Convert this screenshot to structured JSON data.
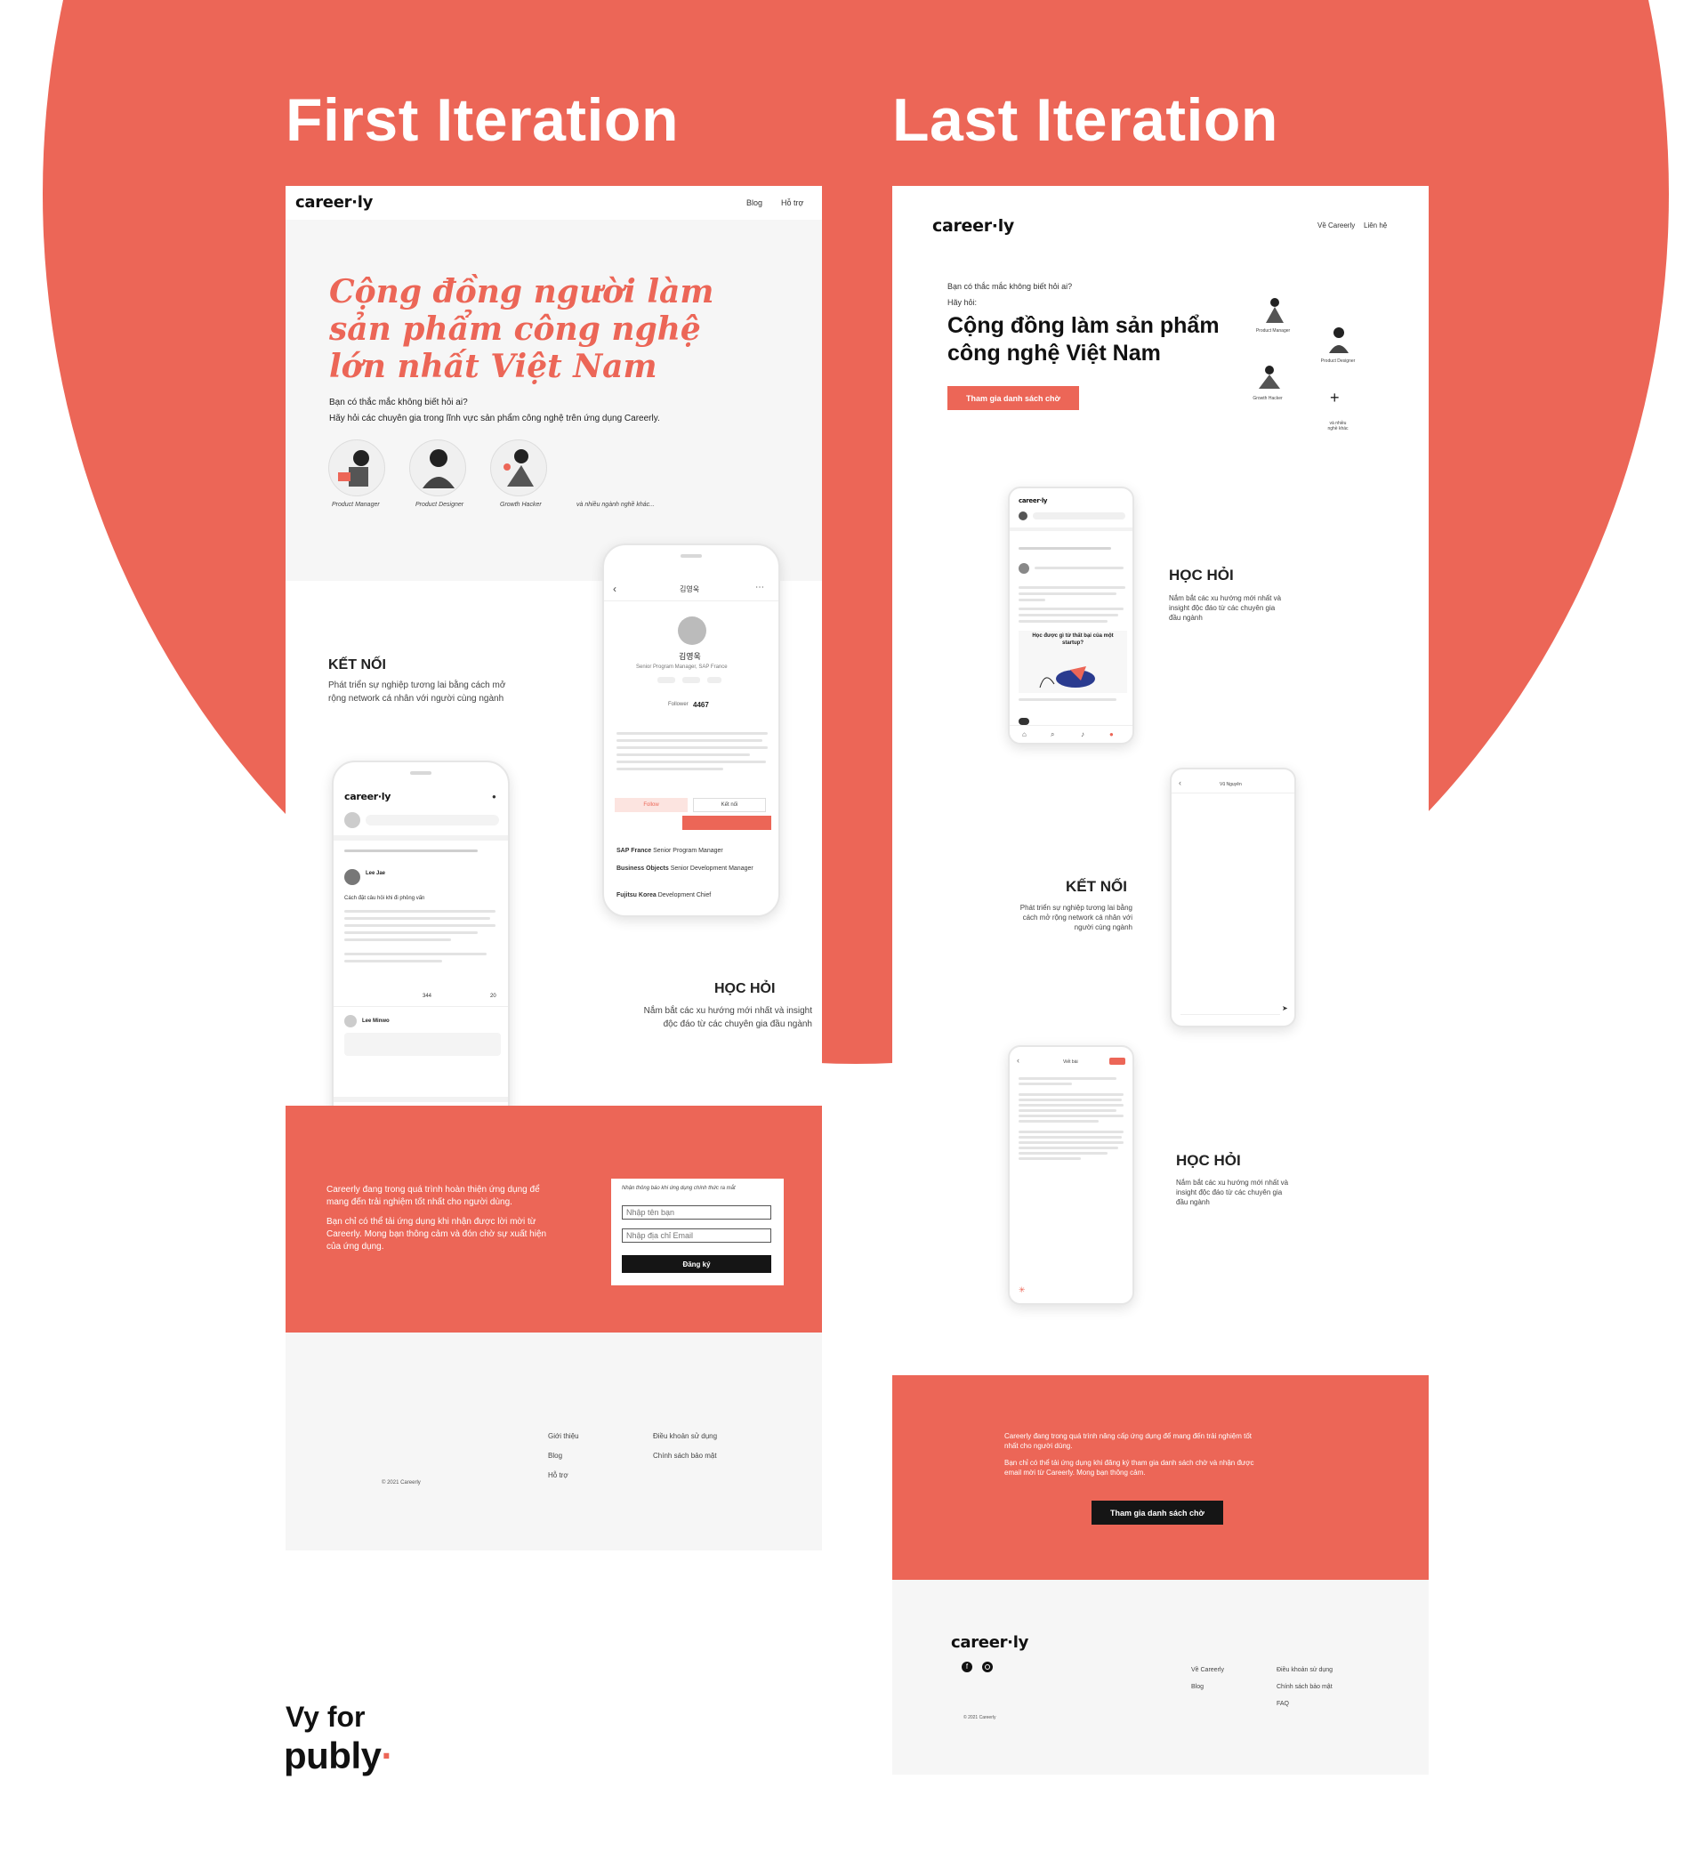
{
  "headings": {
    "first": "First Iteration",
    "last": "Last Iteration"
  },
  "brand": {
    "logo": "career·ly",
    "coral": "#ec6657",
    "dark": "#151515"
  },
  "credit": {
    "line1": "Vy for",
    "line2": "publy"
  },
  "first": {
    "nav": [
      "Blog",
      "Hỗ trợ"
    ],
    "hero_title": [
      "Cộng đồng người làm",
      "sản phẩm công nghệ",
      "lớn nhất Việt Nam"
    ],
    "hero_sub1": "Bạn có thắc mắc không biết hỏi ai?",
    "hero_sub2": "Hãy hỏi các chuyên gia trong lĩnh vực sản phẩm công nghệ trên ứng dụng Careerly.",
    "roles": [
      "Product Manager",
      "Product Designer",
      "Growth Hacker",
      "và nhiều ngành nghề khác..."
    ],
    "connect_title": "KẾT NỐI",
    "connect_text": [
      "Phát triển sự nghiệp tương lai bằng cách mở",
      "rộng network cá nhân với người cùng ngành"
    ],
    "learn_title": "HỌC HỎI",
    "learn_text": [
      "Nắm bắt các xu hướng mới nhất và insight",
      "độc đáo từ các chuyên gia đầu ngành"
    ],
    "profile": {
      "header": "김영욱",
      "name": "김영욱",
      "role": "Senior Program Manager, SAP France",
      "followers_label": "Follower",
      "followers": "4467",
      "follow_btn": "Follow",
      "connect_btn": "Kết nối",
      "exp": [
        {
          "company": "SAP France",
          "title": "Senior Program Manager"
        },
        {
          "company": "Business Objects",
          "title": "Senior Development Manager"
        },
        {
          "company": "Fujitsu Korea",
          "title": "Development Chief"
        }
      ]
    },
    "feed": {
      "logo": "career·ly",
      "post_author": "Lee Jae",
      "post_title": "Cách đặt câu hỏi khi đi phỏng vấn",
      "stat1": "344",
      "stat2": "20",
      "comment_author": "Lee Minwo"
    },
    "cta_text1": [
      "Careerly đang trong quá trình hoàn thiện ứng dụng để",
      "mang đến trải nghiệm tốt nhất cho người dùng."
    ],
    "cta_text2": [
      "Bạn chỉ có thể tải ứng dụng khi nhận được lời mời từ",
      "Careerly. Mong bạn thông cảm và đón chờ sự xuất hiện",
      "của ứng dụng."
    ],
    "form_title": "Nhận thông báo khi ứng dụng chính thức ra mắt",
    "name_placeholder": "Nhập tên bạn",
    "email_placeholder": "Nhập địa chỉ Email",
    "submit": "Đăng ký",
    "footer_col1": [
      "Giới thiệu",
      "Blog",
      "Hỗ trợ"
    ],
    "footer_col2": [
      "Điều khoản sử dụng",
      "Chính sách bảo mật"
    ],
    "copyright": "© 2021 Careerly"
  },
  "last": {
    "nav": [
      "Về Careerly",
      "Liên hệ"
    ],
    "hero_q": "Bạn có thắc mắc không biết hỏi ai?",
    "hero_ask": "Hãy hỏi:",
    "hero_title": [
      "Cộng đồng làm sản phẩm",
      "công nghệ Việt Nam"
    ],
    "hero_btn": "Tham gia danh sách chờ",
    "roles": [
      "Product Manager",
      "Product Designer",
      "Growth Hacker",
      "và nhiều nghề khác"
    ],
    "plus": "+",
    "learn1_title": "HỌC HỎI",
    "learn1_text": [
      "Nắm bắt các xu hướng mới nhất và",
      "insight độc đáo từ các chuyên gia",
      "đầu ngành"
    ],
    "connect_title": "KẾT NỐI",
    "connect_text": [
      "Phát triển sự nghiệp tương lai bằng",
      "cách mở rộng network cá nhân với",
      "người cùng ngành"
    ],
    "learn2_title": "HỌC HỎI",
    "learn2_text": [
      "Nắm bắt các xu hướng mới nhất và",
      "insight độc đáo từ các chuyên gia",
      "đầu ngành"
    ],
    "phone1_logo": "career·ly",
    "phone1_headline": "Học được gì từ thất bại của một startup?",
    "phone2_header": "Vũ Nguyên",
    "phone3_header": "Viết bài",
    "cta_text1": [
      "Careerly đang trong quá trình nâng cấp ứng dụng để mang đến trải nghiệm tốt",
      "nhất cho người dùng."
    ],
    "cta_text2": [
      "Bạn chỉ có thể tải ứng dụng khi đăng ký tham gia danh sách chờ và nhận được",
      "email mời từ Careerly. Mong bạn thông cảm."
    ],
    "cta_btn": "Tham gia danh sách chờ",
    "footer_logo": "career·ly",
    "footer_col1": [
      "Về Careerly",
      "Blog"
    ],
    "footer_col2": [
      "Điều khoản sử dụng",
      "Chính sách bảo mật",
      "FAQ"
    ],
    "copyright": "© 2021 Careerly"
  }
}
